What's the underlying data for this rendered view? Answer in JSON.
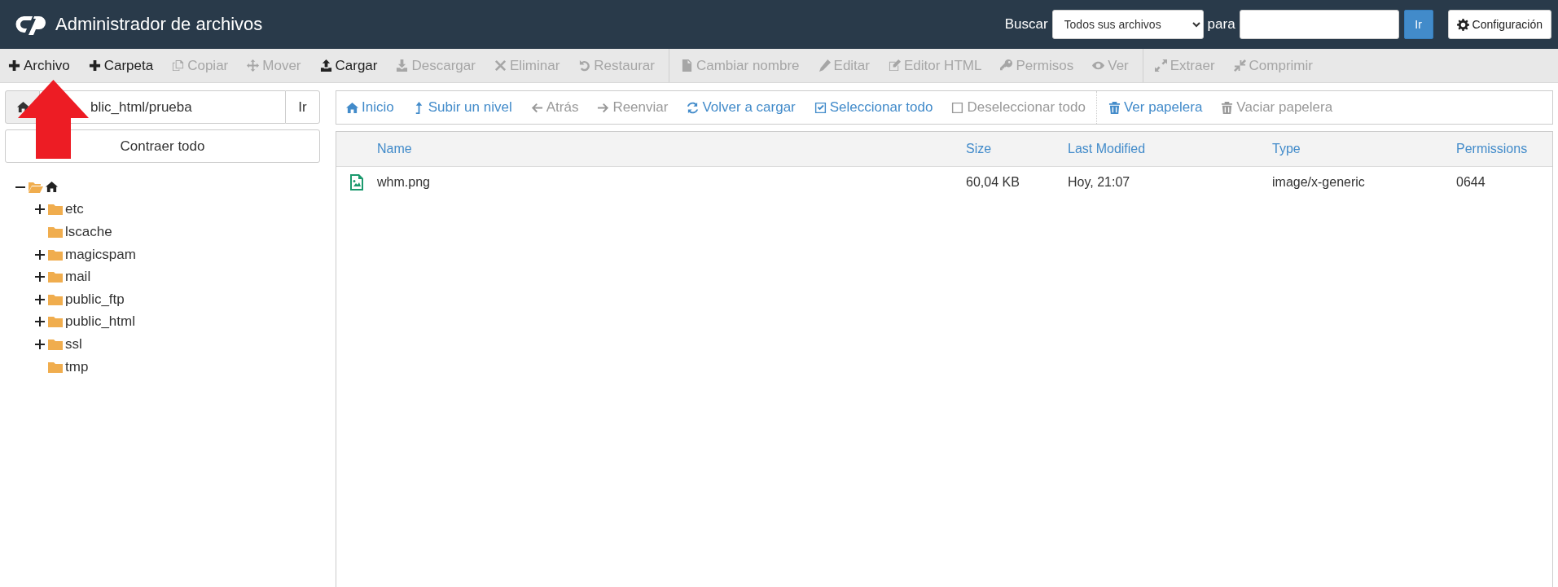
{
  "header": {
    "title": "Administrador de archivos",
    "search_label": "Buscar",
    "search_scope": "Todos sus archivos",
    "for_label": "para",
    "go_button": "Ir",
    "settings_button": "Configuración"
  },
  "toolbar": [
    [
      {
        "label": "Archivo",
        "disabled": false
      },
      {
        "label": "Carpeta",
        "disabled": false
      },
      {
        "label": "Copiar",
        "disabled": true
      },
      {
        "label": "Mover",
        "disabled": true
      },
      {
        "label": "Cargar",
        "disabled": false
      },
      {
        "label": "Descargar",
        "disabled": true
      },
      {
        "label": "Eliminar",
        "disabled": true
      },
      {
        "label": "Restaurar",
        "disabled": true
      }
    ],
    [
      {
        "label": "Cambiar nombre",
        "disabled": true
      },
      {
        "label": "Editar",
        "disabled": true
      },
      {
        "label": "Editor HTML",
        "disabled": true
      },
      {
        "label": "Permisos",
        "disabled": true
      },
      {
        "label": "Ver",
        "disabled": true
      }
    ],
    [
      {
        "label": "Extraer",
        "disabled": true
      },
      {
        "label": "Comprimir",
        "disabled": true
      }
    ]
  ],
  "path_bar": {
    "value": "blic_html/prueba",
    "go_button": "Ir"
  },
  "collapse_button": "Contraer todo",
  "tree": {
    "expanded": true,
    "children": [
      {
        "label": "etc",
        "has_children": true,
        "expanded": false
      },
      {
        "label": "lscache",
        "has_children": false
      },
      {
        "label": "magicspam",
        "has_children": true,
        "expanded": false
      },
      {
        "label": "mail",
        "has_children": true,
        "expanded": false
      },
      {
        "label": "public_ftp",
        "has_children": true,
        "expanded": false
      },
      {
        "label": "public_html",
        "has_children": true,
        "expanded": false
      },
      {
        "label": "ssl",
        "has_children": true,
        "expanded": false
      },
      {
        "label": "tmp",
        "has_children": false
      }
    ]
  },
  "nav": [
    [
      {
        "label": "Inicio",
        "disabled": false
      },
      {
        "label": "Subir un nivel",
        "disabled": false
      },
      {
        "label": "Atrás",
        "disabled": true
      },
      {
        "label": "Reenviar",
        "disabled": true
      },
      {
        "label": "Volver a cargar",
        "disabled": false
      },
      {
        "label": "Seleccionar todo",
        "disabled": false
      },
      {
        "label": "Deseleccionar todo",
        "disabled": true
      }
    ],
    [
      {
        "label": "Ver papelera",
        "disabled": false
      },
      {
        "label": "Vaciar papelera",
        "disabled": true
      }
    ]
  ],
  "table": {
    "columns": [
      "Name",
      "Size",
      "Last Modified",
      "Type",
      "Permissions"
    ],
    "rows": [
      {
        "selected": false,
        "cells": [
          "whm.png",
          "60,04 KB",
          "Hoy, 21:07",
          "image/x-generic",
          "0644"
        ]
      }
    ]
  }
}
